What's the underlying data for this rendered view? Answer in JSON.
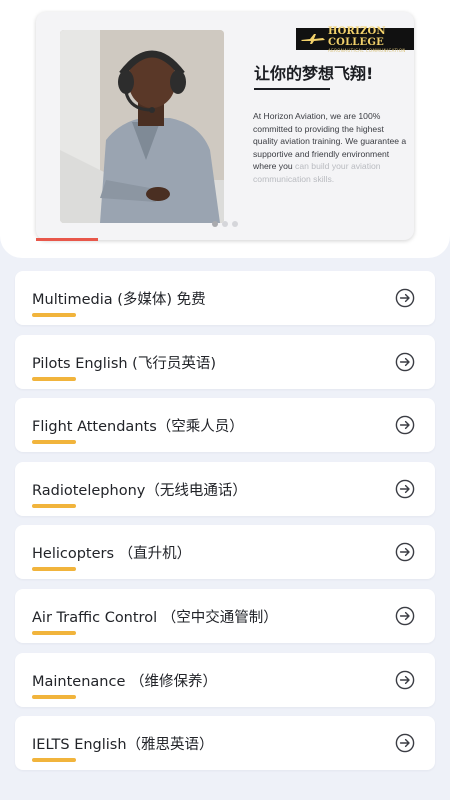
{
  "banner": {
    "logo_name": "HORIZON COLLEGE",
    "logo_sub": "AERONAUTICAL COMMUNICATION",
    "headline": "让你的梦想飞翔!",
    "description": "At Horizon Aviation, we are 100% committed to providing the highest quality aviation training. We guarantee a supportive and friendly environment where you",
    "description_faded": "can build your aviation communication skills.",
    "carousel": {
      "total": 3,
      "active": 1
    },
    "accent_color": "#e8574a"
  },
  "menu": {
    "items": [
      {
        "label": "Multimedia (多媒体) 免费",
        "icon": "arrow-right-circle-icon"
      },
      {
        "label": "Pilots English (飞行员英语)",
        "icon": "arrow-right-circle-icon"
      },
      {
        "label": "Flight Attendants（空乘人员）",
        "icon": "arrow-right-circle-icon"
      },
      {
        "label": "Radiotelephony（无线电通话）",
        "icon": "arrow-right-circle-icon"
      },
      {
        "label": "Helicopters （直升机）",
        "icon": "arrow-right-circle-icon"
      },
      {
        "label": "Air Traffic Control （空中交通管制）",
        "icon": "arrow-right-circle-icon"
      },
      {
        "label": "Maintenance （维修保养）",
        "icon": "arrow-right-circle-icon"
      },
      {
        "label": "IELTS English（雅思英语）",
        "icon": "arrow-right-circle-icon"
      }
    ],
    "underline_color": "#f1b43c"
  }
}
